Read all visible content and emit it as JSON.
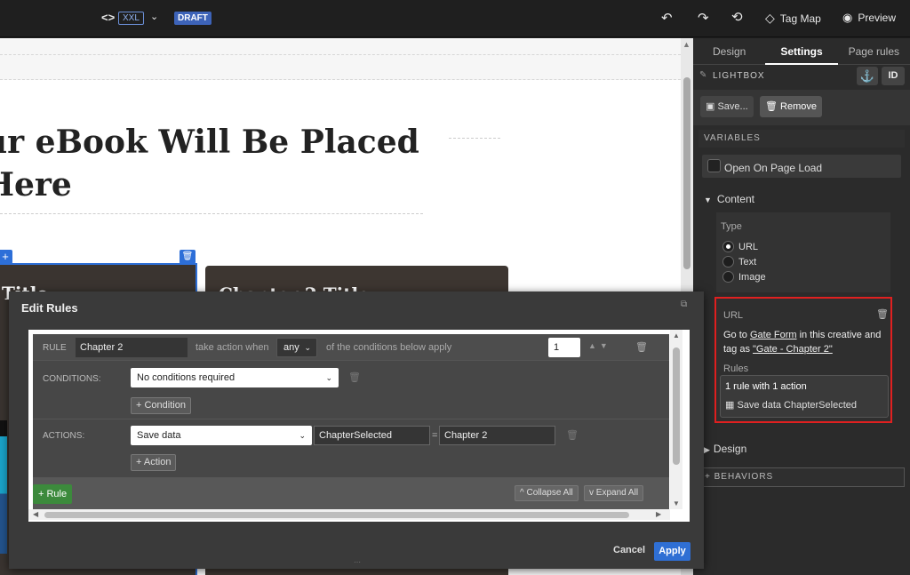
{
  "topbar": {
    "code_icon": "<>",
    "breakpoint": "XXL",
    "status": "DRAFT",
    "tag_map_label": "Tag Map",
    "preview_label": "Preview",
    "icons": [
      "code-icon",
      "chevron-down-icon",
      "undo-icon",
      "redo-icon",
      "history-icon",
      "tag-icon",
      "eye-icon"
    ]
  },
  "canvas": {
    "headline_line1": "ur eBook Will Be Placed",
    "headline_line2": " Here",
    "card1_title": "Title",
    "card2_title": "Chapter 2 Title"
  },
  "panel": {
    "tabs": [
      "Design",
      "Settings",
      "Page rules"
    ],
    "active_tab": "Settings",
    "element_label": "LIGHTBOX",
    "id_label": "ID",
    "save_label": "Save...",
    "remove_label": "Remove",
    "variables_header": "VARIABLES",
    "open_on_load_label": "Open On Page Load",
    "content_label": "Content",
    "type_label": "Type",
    "type_options": [
      "URL",
      "Text",
      "Image"
    ],
    "type_selected": "URL",
    "url_label": "URL",
    "url_desc_prefix": "Go to ",
    "url_desc_target": "Gate Form",
    "url_desc_middle": " in this creative and tag as ",
    "url_desc_tag": "\"Gate - Chapter 2\"",
    "rules_label": "Rules",
    "rules_summary": "1 rule with 1 action",
    "rules_action_prefix": "Save data ",
    "rules_action_name": "ChapterSelected",
    "design_label": "Design",
    "behaviors_header": "+ BEHAVIORS",
    "accent_color": "#e02020"
  },
  "dialog": {
    "title": "Edit Rules",
    "rule_label": "RULE",
    "rule_name": "Chapter 2",
    "take_action_text": "take action when",
    "match_value": "any",
    "conditions_apply_text": "of the conditions below apply",
    "priority": "1",
    "conditions_label": "CONDITIONS:",
    "condition_select": "No conditions required",
    "add_condition_label": "+ Condition",
    "actions_label": "ACTIONS:",
    "action_select": "Save data",
    "action_data_name": "ChapterSelected",
    "action_equals": "=",
    "action_data_value": "Chapter 2",
    "add_action_label": "+ Action",
    "add_rule_label": "+ Rule",
    "collapse_label": "^ Collapse All",
    "expand_label": "v Expand All",
    "cancel_label": "Cancel",
    "apply_label": "Apply",
    "apply_color": "#2f6fd4"
  }
}
